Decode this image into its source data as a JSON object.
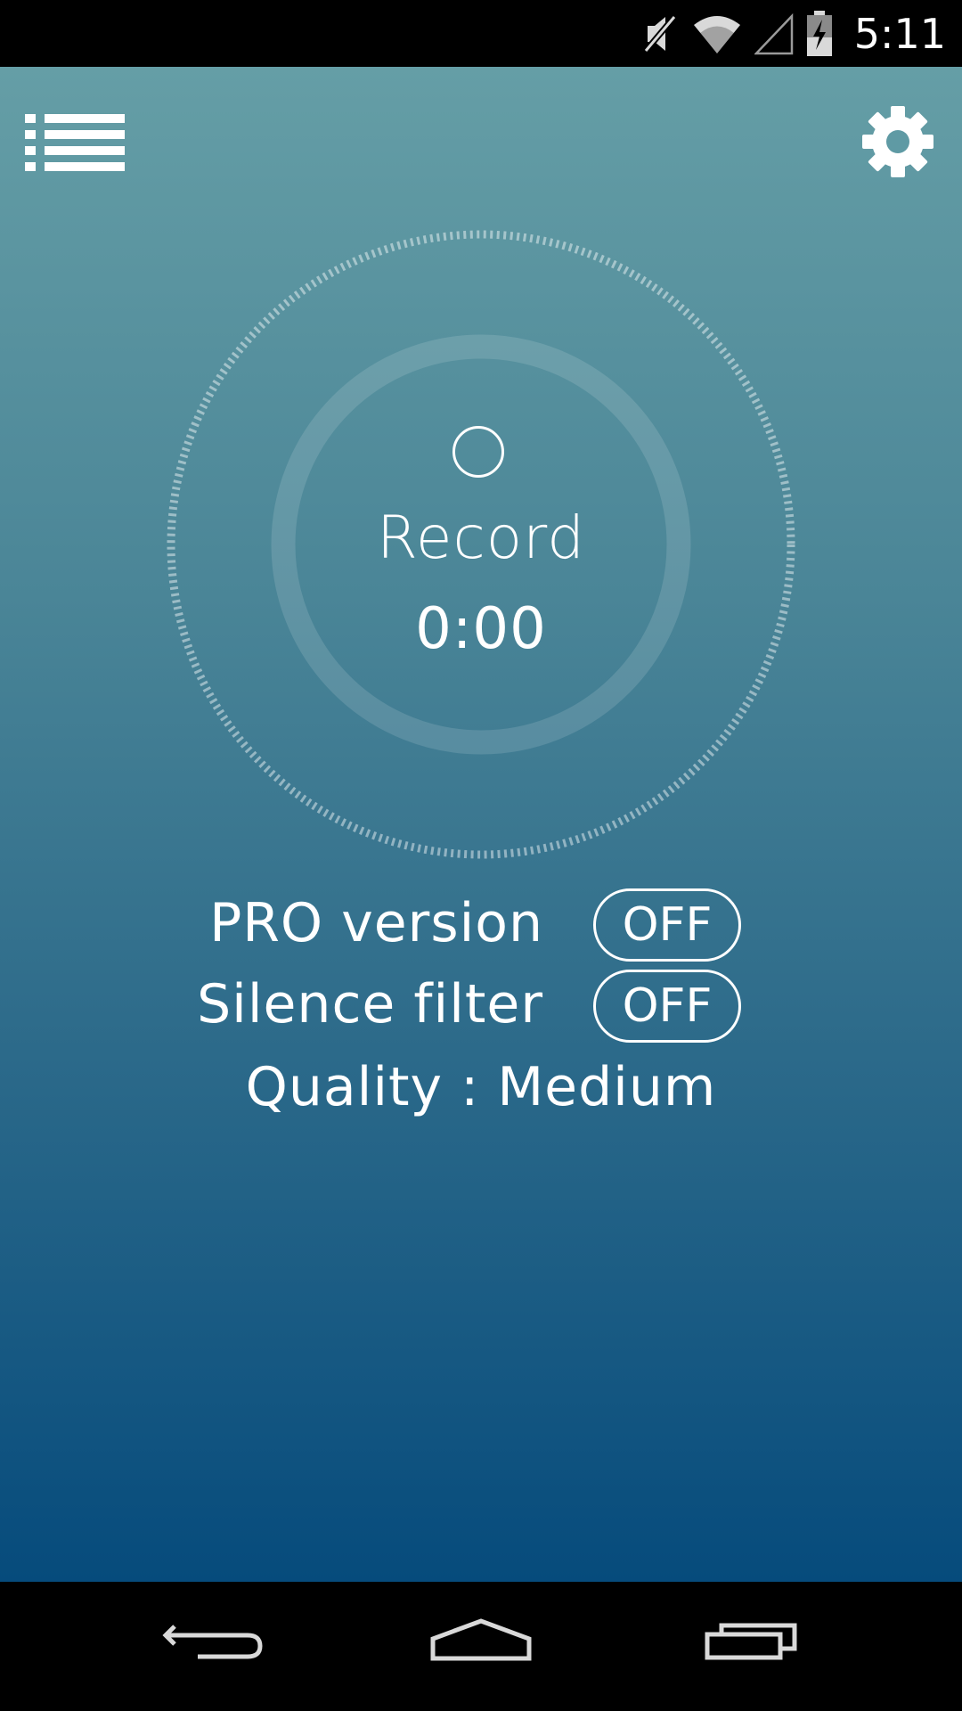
{
  "status_bar": {
    "time": "5:11",
    "icons": [
      "mute-icon",
      "wifi-icon",
      "signal-icon",
      "battery-charging-icon"
    ]
  },
  "toolbar": {
    "menu_icon": "list-icon",
    "settings_icon": "gear-icon"
  },
  "recorder": {
    "record_label": "Record",
    "timer": "0:00"
  },
  "options": {
    "pro_label": "PRO version",
    "pro_state": "OFF",
    "silence_label": "Silence filter",
    "silence_state": "OFF",
    "quality": "Quality : Medium"
  },
  "nav": {
    "icons": [
      "back-icon",
      "home-icon",
      "recents-icon"
    ]
  },
  "colors": {
    "gradient_top": "#659ea6",
    "gradient_bottom": "#064b7c",
    "foreground": "#ffffff"
  }
}
